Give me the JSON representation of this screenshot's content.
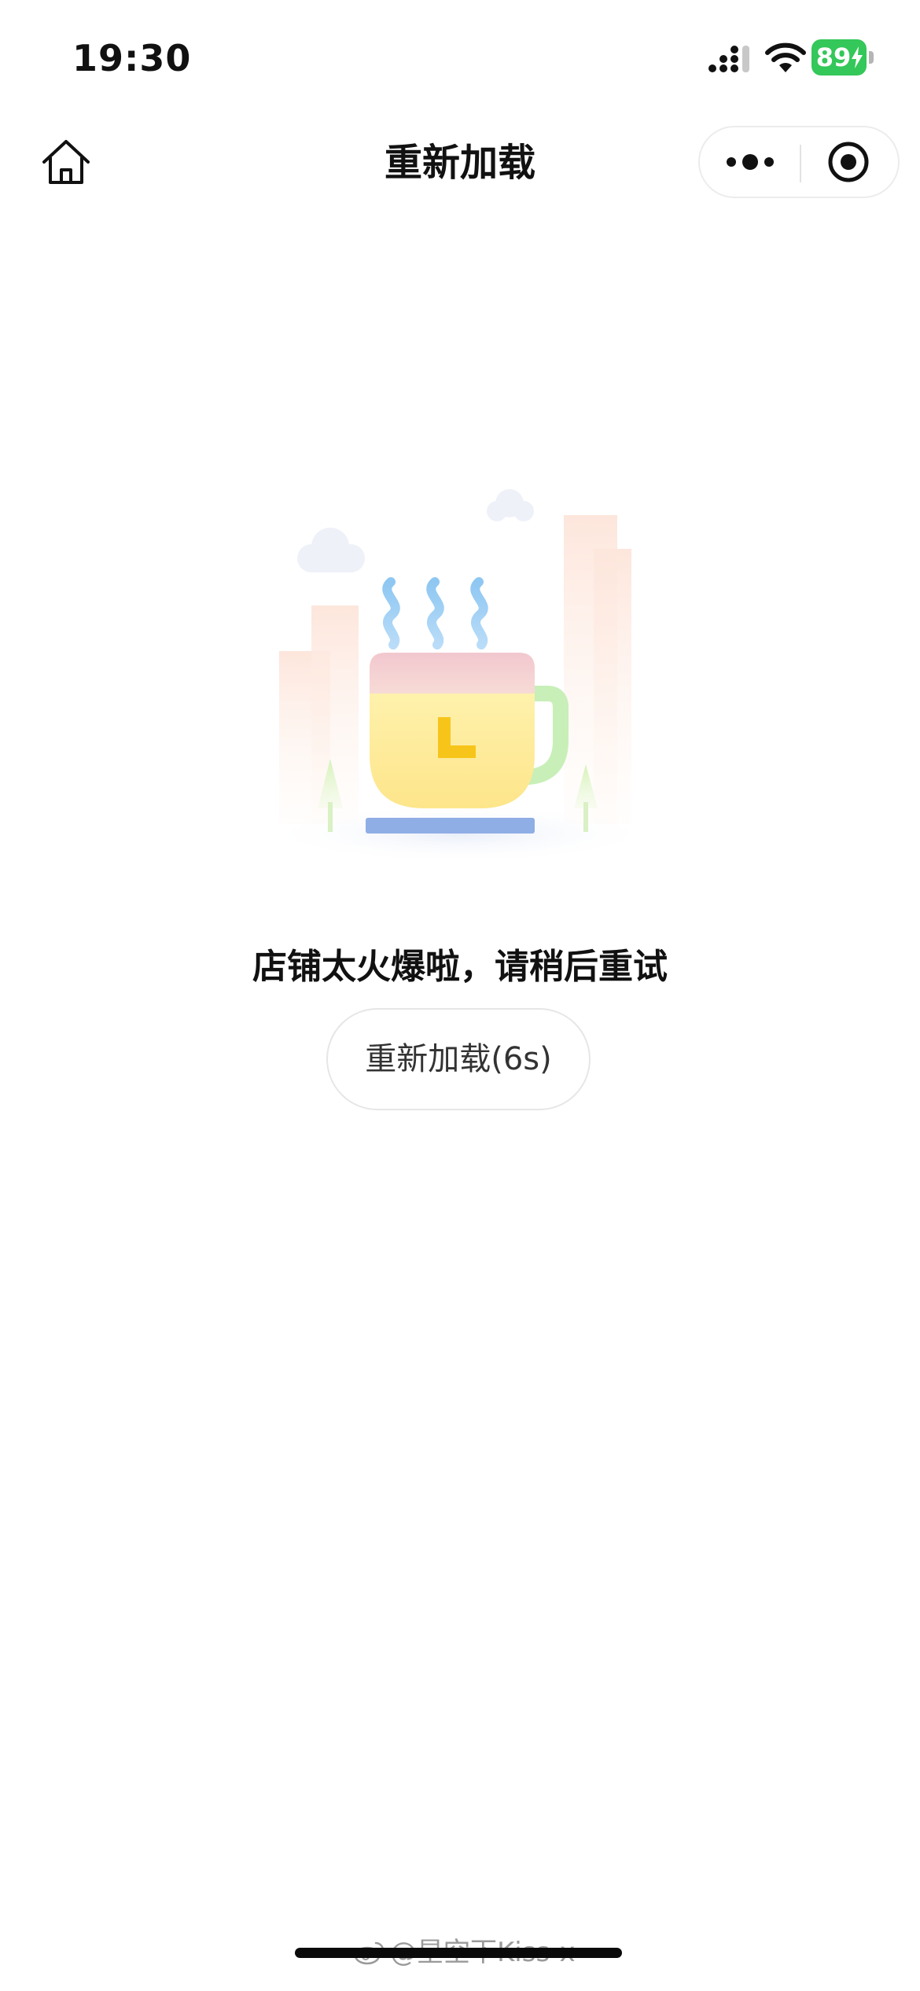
{
  "status_bar": {
    "time": "19:30",
    "battery_percent": "89",
    "signal_icon": "cellular-signal-icon",
    "wifi_icon": "wifi-icon",
    "battery_icon": "battery-charging-icon",
    "battery_color": "#34c759"
  },
  "nav_bar": {
    "title": "重新加载",
    "home_icon": "home-icon",
    "more_icon": "more-dots-icon",
    "close_icon": "target-close-icon"
  },
  "illustration": {
    "icon": "coffee-cup-busy-illustration",
    "cup_letter": "L"
  },
  "main": {
    "message": "店铺太火爆啦，请稍后重试",
    "reload_button_label": "重新加载(6s)"
  },
  "watermark": {
    "text": "@星空下Kiss-x",
    "icon": "weibo-icon"
  }
}
